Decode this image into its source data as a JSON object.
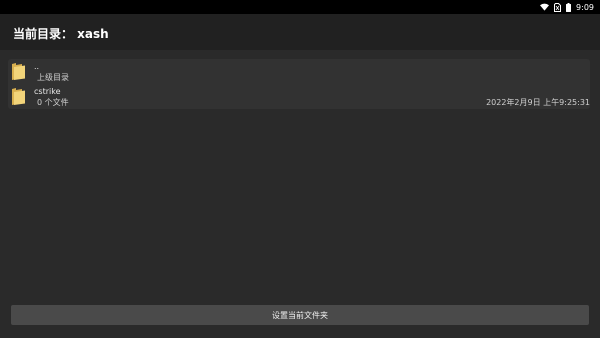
{
  "status": {
    "time": "9:09"
  },
  "header": {
    "title": "当前目录： xash"
  },
  "files": [
    {
      "name": "..",
      "subtitle": "上级目录",
      "date": ""
    },
    {
      "name": "cstrike",
      "subtitle": "0 个文件",
      "date": "2022年2月9日 上午9:25:31"
    }
  ],
  "footer": {
    "button_label": "设置当前文件夹"
  },
  "colors": {
    "folder": "#f2d47a",
    "folder_dark": "#d9b04f",
    "background": "#2a2a2a"
  }
}
